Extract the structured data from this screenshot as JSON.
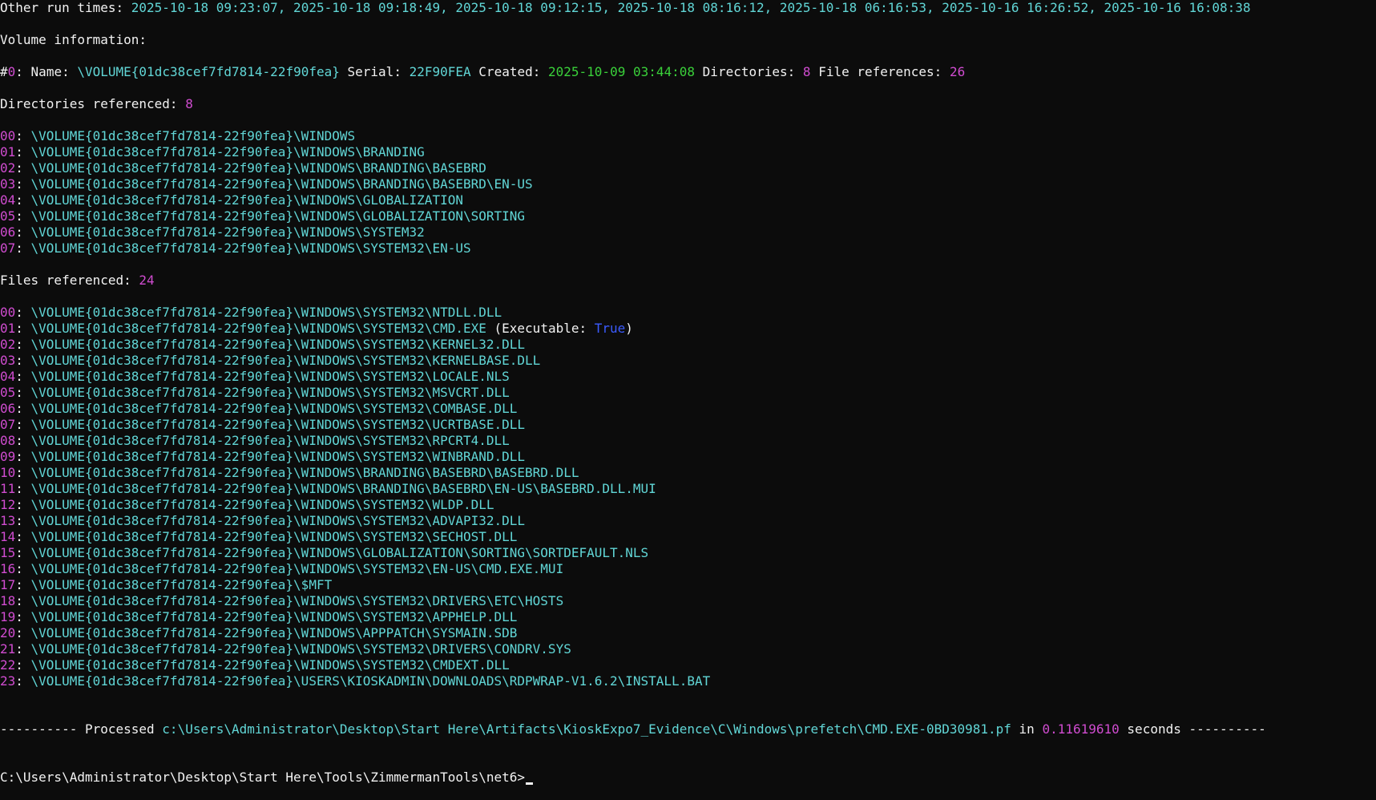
{
  "colors": {
    "background": "#0c0c0c",
    "text": "#f2f2f2",
    "cyan": "#61d6d6",
    "magenta": "#d04cd0",
    "green": "#3ad13a",
    "blue": "#3b5bff"
  },
  "run_times": {
    "label": "Other run times:",
    "value": "2025-10-18 09:23:07, 2025-10-18 09:18:49, 2025-10-18 09:12:15, 2025-10-18 08:16:12, 2025-10-18 06:16:53, 2025-10-16 16:26:52, 2025-10-16 16:08:38"
  },
  "volume": {
    "heading": "Volume information:",
    "hash": "#",
    "index": "0",
    "name_label": ": Name:",
    "name": "\\VOLUME{01dc38cef7fd7814-22f90fea}",
    "serial_label": "Serial:",
    "serial": "22F90FEA",
    "created_label": "Created:",
    "created": "2025-10-09 03:44:08",
    "dirs_label": "Directories:",
    "dirs": "8",
    "filerefs_label": "File references:",
    "filerefs": "26"
  },
  "directories": {
    "label": "Directories referenced:",
    "count": "8",
    "items": [
      {
        "idx": "00",
        "path": "\\VOLUME{01dc38cef7fd7814-22f90fea}\\WINDOWS"
      },
      {
        "idx": "01",
        "path": "\\VOLUME{01dc38cef7fd7814-22f90fea}\\WINDOWS\\BRANDING"
      },
      {
        "idx": "02",
        "path": "\\VOLUME{01dc38cef7fd7814-22f90fea}\\WINDOWS\\BRANDING\\BASEBRD"
      },
      {
        "idx": "03",
        "path": "\\VOLUME{01dc38cef7fd7814-22f90fea}\\WINDOWS\\BRANDING\\BASEBRD\\EN-US"
      },
      {
        "idx": "04",
        "path": "\\VOLUME{01dc38cef7fd7814-22f90fea}\\WINDOWS\\GLOBALIZATION"
      },
      {
        "idx": "05",
        "path": "\\VOLUME{01dc38cef7fd7814-22f90fea}\\WINDOWS\\GLOBALIZATION\\SORTING"
      },
      {
        "idx": "06",
        "path": "\\VOLUME{01dc38cef7fd7814-22f90fea}\\WINDOWS\\SYSTEM32"
      },
      {
        "idx": "07",
        "path": "\\VOLUME{01dc38cef7fd7814-22f90fea}\\WINDOWS\\SYSTEM32\\EN-US"
      }
    ]
  },
  "files": {
    "label": "Files referenced:",
    "count": "24",
    "executable_label": "(Executable:",
    "executable_value": "True",
    "executable_close": ")",
    "items": [
      {
        "idx": "00",
        "path": "\\VOLUME{01dc38cef7fd7814-22f90fea}\\WINDOWS\\SYSTEM32\\NTDLL.DLL"
      },
      {
        "idx": "01",
        "path": "\\VOLUME{01dc38cef7fd7814-22f90fea}\\WINDOWS\\SYSTEM32\\CMD.EXE",
        "executable": true
      },
      {
        "idx": "02",
        "path": "\\VOLUME{01dc38cef7fd7814-22f90fea}\\WINDOWS\\SYSTEM32\\KERNEL32.DLL"
      },
      {
        "idx": "03",
        "path": "\\VOLUME{01dc38cef7fd7814-22f90fea}\\WINDOWS\\SYSTEM32\\KERNELBASE.DLL"
      },
      {
        "idx": "04",
        "path": "\\VOLUME{01dc38cef7fd7814-22f90fea}\\WINDOWS\\SYSTEM32\\LOCALE.NLS"
      },
      {
        "idx": "05",
        "path": "\\VOLUME{01dc38cef7fd7814-22f90fea}\\WINDOWS\\SYSTEM32\\MSVCRT.DLL"
      },
      {
        "idx": "06",
        "path": "\\VOLUME{01dc38cef7fd7814-22f90fea}\\WINDOWS\\SYSTEM32\\COMBASE.DLL"
      },
      {
        "idx": "07",
        "path": "\\VOLUME{01dc38cef7fd7814-22f90fea}\\WINDOWS\\SYSTEM32\\UCRTBASE.DLL"
      },
      {
        "idx": "08",
        "path": "\\VOLUME{01dc38cef7fd7814-22f90fea}\\WINDOWS\\SYSTEM32\\RPCRT4.DLL"
      },
      {
        "idx": "09",
        "path": "\\VOLUME{01dc38cef7fd7814-22f90fea}\\WINDOWS\\SYSTEM32\\WINBRAND.DLL"
      },
      {
        "idx": "10",
        "path": "\\VOLUME{01dc38cef7fd7814-22f90fea}\\WINDOWS\\BRANDING\\BASEBRD\\BASEBRD.DLL"
      },
      {
        "idx": "11",
        "path": "\\VOLUME{01dc38cef7fd7814-22f90fea}\\WINDOWS\\BRANDING\\BASEBRD\\EN-US\\BASEBRD.DLL.MUI"
      },
      {
        "idx": "12",
        "path": "\\VOLUME{01dc38cef7fd7814-22f90fea}\\WINDOWS\\SYSTEM32\\WLDP.DLL"
      },
      {
        "idx": "13",
        "path": "\\VOLUME{01dc38cef7fd7814-22f90fea}\\WINDOWS\\SYSTEM32\\ADVAPI32.DLL"
      },
      {
        "idx": "14",
        "path": "\\VOLUME{01dc38cef7fd7814-22f90fea}\\WINDOWS\\SYSTEM32\\SECHOST.DLL"
      },
      {
        "idx": "15",
        "path": "\\VOLUME{01dc38cef7fd7814-22f90fea}\\WINDOWS\\GLOBALIZATION\\SORTING\\SORTDEFAULT.NLS"
      },
      {
        "idx": "16",
        "path": "\\VOLUME{01dc38cef7fd7814-22f90fea}\\WINDOWS\\SYSTEM32\\EN-US\\CMD.EXE.MUI"
      },
      {
        "idx": "17",
        "path": "\\VOLUME{01dc38cef7fd7814-22f90fea}\\$MFT"
      },
      {
        "idx": "18",
        "path": "\\VOLUME{01dc38cef7fd7814-22f90fea}\\WINDOWS\\SYSTEM32\\DRIVERS\\ETC\\HOSTS"
      },
      {
        "idx": "19",
        "path": "\\VOLUME{01dc38cef7fd7814-22f90fea}\\WINDOWS\\SYSTEM32\\APPHELP.DLL"
      },
      {
        "idx": "20",
        "path": "\\VOLUME{01dc38cef7fd7814-22f90fea}\\WINDOWS\\APPPATCH\\SYSMAIN.SDB"
      },
      {
        "idx": "21",
        "path": "\\VOLUME{01dc38cef7fd7814-22f90fea}\\WINDOWS\\SYSTEM32\\DRIVERS\\CONDRV.SYS"
      },
      {
        "idx": "22",
        "path": "\\VOLUME{01dc38cef7fd7814-22f90fea}\\WINDOWS\\SYSTEM32\\CMDEXT.DLL"
      },
      {
        "idx": "23",
        "path": "\\VOLUME{01dc38cef7fd7814-22f90fea}\\USERS\\KIOSKADMIN\\DOWNLOADS\\RDPWRAP-V1.6.2\\INSTALL.BAT"
      }
    ]
  },
  "processed": {
    "prefix": "---------- Processed",
    "path": "c:\\Users\\Administrator\\Desktop\\Start Here\\Artifacts\\KioskExpo7_Evidence\\C\\Windows\\prefetch\\CMD.EXE-0BD30981.pf",
    "in_label": "in",
    "seconds_value": "0.11619610",
    "suffix": "seconds ----------"
  },
  "prompt": {
    "text": "C:\\Users\\Administrator\\Desktop\\Start Here\\Tools\\ZimmermanTools\\net6>"
  }
}
